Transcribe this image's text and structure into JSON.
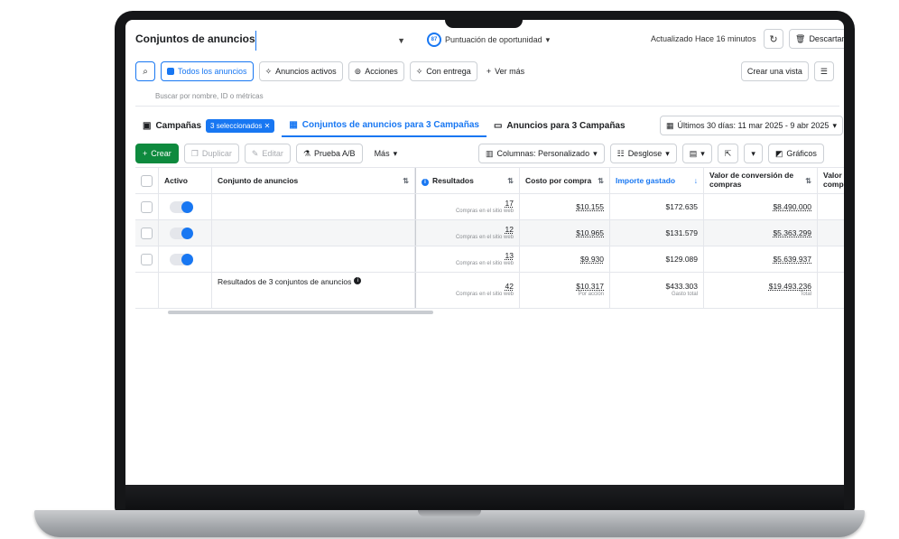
{
  "topbar": {
    "title": "Conjuntos de anuncios",
    "score_badge": "87",
    "score_label": "Puntuación de oportunidad",
    "updated": "Actualizado Hace 16 minutos",
    "discard": "Descartar"
  },
  "filters": {
    "all_ads": "Todos los anuncios",
    "active_ads": "Anuncios activos",
    "actions": "Acciones",
    "with_delivery": "Con entrega",
    "see_more": "Ver más",
    "create_view": "Crear una vista",
    "search_placeholder": "Buscar por nombre, ID o métricas"
  },
  "tabs": {
    "campaigns": "Campañas",
    "selected": "3 seleccionados",
    "adsets": "Conjuntos de anuncios para 3 Campañas",
    "ads": "Anuncios para 3 Campañas",
    "date_range": "Últimos 30 días: 11 mar 2025 - 9 abr 2025"
  },
  "toolbar": {
    "create": "Crear",
    "duplicate": "Duplicar",
    "edit": "Editar",
    "ab_test": "Prueba A/B",
    "more": "Más",
    "columns": "Columnas: Personalizado",
    "breakdown": "Desglose",
    "charts": "Gráficos"
  },
  "table": {
    "headers": {
      "active": "Activo",
      "adset": "Conjunto de anuncios",
      "results": "Resultados",
      "cost_per_purchase": "Costo por compra",
      "amount_spent": "Importe gastado",
      "conversion_value": "Valor de conversión de compras",
      "next_col": "Valor comp"
    },
    "rows": [
      {
        "results": "17",
        "results_sub": "Compras en el sitio web",
        "cost": "$10.155",
        "spent": "$172.635",
        "value": "$8.490.000"
      },
      {
        "results": "12",
        "results_sub": "Compras en el sitio web",
        "cost": "$10.965",
        "spent": "$131.579",
        "value": "$5.363.299"
      },
      {
        "results": "13",
        "results_sub": "Compras en el sitio web",
        "cost": "$9.930",
        "spent": "$129.089",
        "value": "$5.639.937"
      }
    ],
    "summary": {
      "label": "Resultados de 3 conjuntos de anuncios",
      "results": "42",
      "results_sub": "Compras en el sitio web",
      "cost": "$10.317",
      "cost_sub": "Por acción",
      "spent": "$433.303",
      "spent_sub": "Gasto total",
      "value": "$19.493.236",
      "value_sub": "Total"
    }
  },
  "colors": {
    "accent": "#1877f2",
    "create_button": "#0e8a3e"
  }
}
